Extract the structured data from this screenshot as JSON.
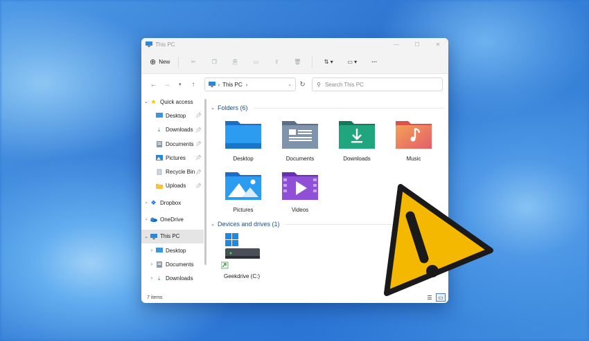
{
  "window": {
    "title": "This PC"
  },
  "toolbar": {
    "new_label": "New",
    "icons": [
      "cut-icon",
      "copy-icon",
      "paste-icon",
      "rename-icon",
      "share-icon",
      "delete-icon",
      "sort-icon",
      "view-icon",
      "more-icon"
    ]
  },
  "address": {
    "location": "This PC",
    "search_placeholder": "Search This PC"
  },
  "sidebar": {
    "quick_access": "Quick access",
    "items": [
      {
        "label": "Desktop",
        "pinned": true
      },
      {
        "label": "Downloads",
        "pinned": true
      },
      {
        "label": "Documents",
        "pinned": true
      },
      {
        "label": "Pictures",
        "pinned": true
      },
      {
        "label": "Recycle Bin",
        "pinned": true
      },
      {
        "label": "Uploads",
        "pinned": true
      }
    ],
    "dropbox": "Dropbox",
    "onedrive": "OneDrive",
    "this_pc": "This PC",
    "this_pc_items": [
      "Desktop",
      "Documents",
      "Downloads"
    ]
  },
  "content": {
    "folders_header": "Folders (6)",
    "folders": [
      "Desktop",
      "Documents",
      "Downloads",
      "Music",
      "Pictures",
      "Videos"
    ],
    "devices_header": "Devices and drives (1)",
    "drives": [
      "Geekdrive (C:)"
    ]
  },
  "status": {
    "item_count": "7 items"
  },
  "colors": {
    "accent": "#1f4e8c",
    "warning": "#f5b800"
  }
}
